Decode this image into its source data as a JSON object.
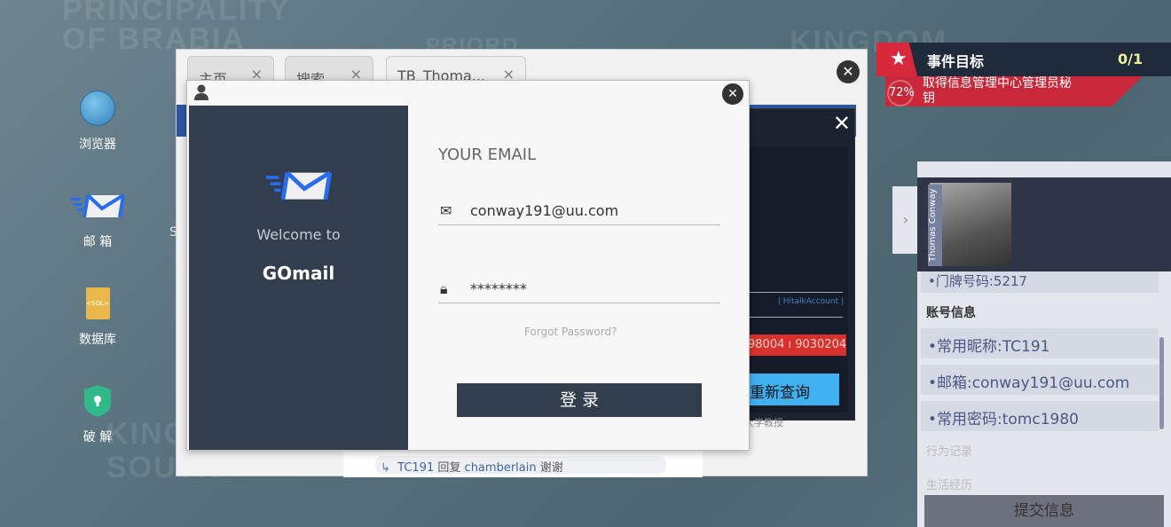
{
  "map_labels": [
    "PRINCIPALITY",
    "OF BRABIA",
    "PRIORD",
    "KINGDOM",
    "KINGD",
    "SOUTH"
  ],
  "desktop": [
    {
      "label": "浏览器",
      "icon": "globe-icon"
    },
    {
      "label": "邮 箱",
      "icon": "mail-icon"
    },
    {
      "label": "数据库",
      "icon": "sql-file-icon",
      "icon_text": "<SQL>"
    },
    {
      "label": "破 解",
      "icon": "shield-key-icon"
    }
  ],
  "desktop_partial": "S",
  "browser": {
    "tabs": [
      {
        "label": "主页"
      },
      {
        "label": "搜索"
      },
      {
        "label": "TB_Thoma..."
      }
    ],
    "tab_close": "×",
    "behind": {
      "column_label": "| HitalkAccount |",
      "red_values": "98004 ı 9030204 ı",
      "requery_label": "重新查询",
      "caption": "大学教授"
    },
    "comment": {
      "user": "TC191",
      "verb": "回复",
      "target": "chamberlain",
      "text": "谢谢"
    }
  },
  "login": {
    "welcome": "Welcome to",
    "app_name": "GOmail",
    "email_heading": "YOUR EMAIL",
    "email_value": "conway191@uu.com",
    "password_value": "********",
    "forgot": "Forgot Password?",
    "submit": "登 录"
  },
  "goal": {
    "title": "事件目标",
    "count": "0/1",
    "progress": "72%",
    "progress_value": 72,
    "task": "取得信息管理中心管理员秘钥",
    "colors": {
      "red": "#d8283c",
      "navy": "#1f2a3a",
      "count": "#e8f0a0"
    }
  },
  "profile": {
    "name": "Thomas Conway",
    "partial_item": "•门牌号码:5217",
    "section": "账号信息",
    "items": [
      "•常用昵称:TC191",
      "•邮箱:conway191@uu.com",
      "•常用密码:tomc1980"
    ],
    "faded": [
      "行为记录",
      "生活经历"
    ],
    "submit": "提交信息"
  }
}
